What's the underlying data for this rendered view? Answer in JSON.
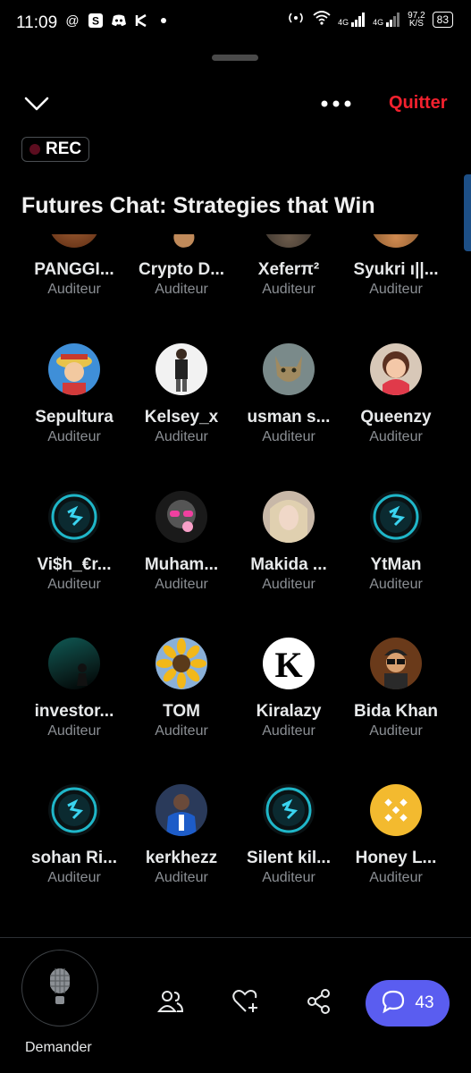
{
  "status_bar": {
    "time": "11:09",
    "left_icons": [
      "at-icon",
      "s-app-icon",
      "discord-icon",
      "k-app-icon",
      "dot-icon"
    ],
    "net_speed_value": "97,2",
    "net_speed_unit": "K/S",
    "network_labels": [
      "4G",
      "4G"
    ],
    "battery": "83"
  },
  "header": {
    "quit_label": "Quitter",
    "rec_label": "REC",
    "title": "Futures Chat: Strategies that Win"
  },
  "participants": [
    {
      "name": "PANGGI...",
      "role": "Auditeur",
      "avatar": "partial-avatar"
    },
    {
      "name": "Crypto D...",
      "role": "Auditeur",
      "avatar": "partial-avatar"
    },
    {
      "name": "Xeferπ²",
      "role": "Auditeur",
      "avatar": "partial-avatar"
    },
    {
      "name": "Syukri ı||...",
      "role": "Auditeur",
      "avatar": "partial-avatar"
    },
    {
      "name": "Sepultura",
      "role": "Auditeur",
      "avatar": "cartoon-pirate-avatar"
    },
    {
      "name": "Kelsey_x",
      "role": "Auditeur",
      "avatar": "person-photo-avatar"
    },
    {
      "name": "usman s...",
      "role": "Auditeur",
      "avatar": "cat-avatar"
    },
    {
      "name": "Queenzy",
      "role": "Auditeur",
      "avatar": "cartoon-girl-avatar"
    },
    {
      "name": "Vi$h_€r...",
      "role": "Auditeur",
      "avatar": "logo-avatar"
    },
    {
      "name": "Muham...",
      "role": "Auditeur",
      "avatar": "pink-glasses-avatar"
    },
    {
      "name": "Makida ...",
      "role": "Auditeur",
      "avatar": "woman-photo-avatar"
    },
    {
      "name": "YtMan",
      "role": "Auditeur",
      "avatar": "logo-avatar"
    },
    {
      "name": "investor...",
      "role": "Auditeur",
      "avatar": "dark-teal-avatar"
    },
    {
      "name": "TOM",
      "role": "Auditeur",
      "avatar": "sunflower-avatar"
    },
    {
      "name": "Kiralazy",
      "role": "Auditeur",
      "avatar": "letter-k-avatar"
    },
    {
      "name": "Bida Khan",
      "role": "Auditeur",
      "avatar": "cartoon-boy-avatar"
    },
    {
      "name": "sohan Ri...",
      "role": "Auditeur",
      "avatar": "logo-avatar"
    },
    {
      "name": "kerkhezz",
      "role": "Auditeur",
      "avatar": "football-player-avatar"
    },
    {
      "name": "Silent kil...",
      "role": "Auditeur",
      "avatar": "logo-avatar"
    },
    {
      "name": "Honey L...",
      "role": "Auditeur",
      "avatar": "binance-logo-avatar"
    }
  ],
  "bottom_bar": {
    "ask_label": "Demander",
    "chat_count": "43"
  },
  "colors": {
    "background": "#000000",
    "quit": "#f4212e",
    "chat_button": "#5a5df0",
    "role_text": "#8b8f94"
  }
}
